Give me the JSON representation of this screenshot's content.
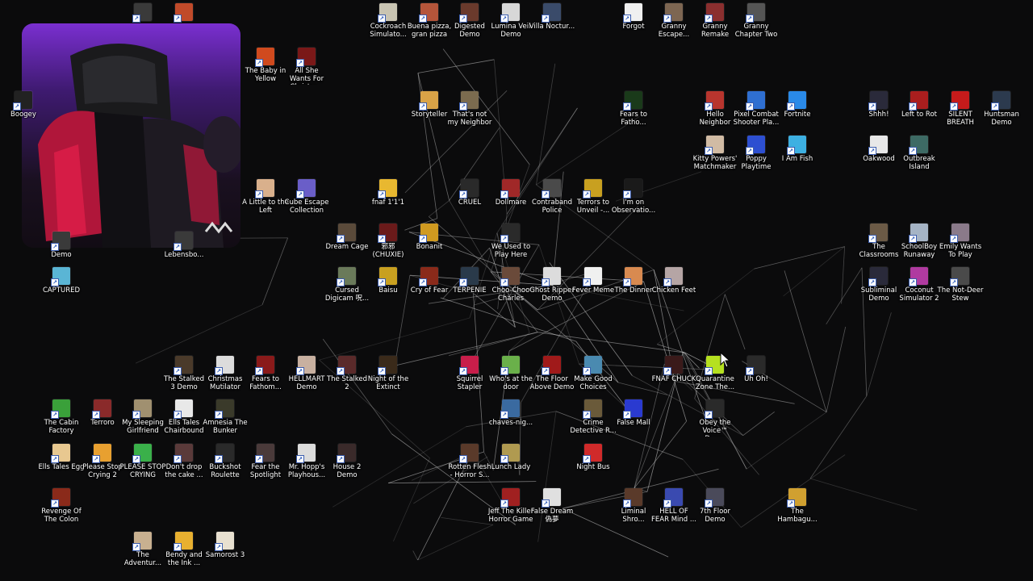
{
  "desktop": {
    "icons": [
      {
        "label": "Cockroach Simulato...",
        "color": "#c9c4b2"
      },
      {
        "label": "Buena pizza, gran pizza",
        "color": "#b5553a"
      },
      {
        "label": "Digested Demo",
        "color": "#6a3a2c"
      },
      {
        "label": "Lumina Veil Demo",
        "color": "#d8d8d8"
      },
      {
        "label": "Villa Noctur...",
        "color": "#3a4b6a"
      },
      {
        "label": "Forgot",
        "color": "#f0f0f0"
      },
      {
        "label": "Granny Escape...",
        "color": "#7d6652"
      },
      {
        "label": "Granny Remake",
        "color": "#8b2f2f"
      },
      {
        "label": "Granny Chapter Two",
        "color": "#555555"
      },
      {
        "label": "The Baby in Yellow",
        "color": "#d04a1e"
      },
      {
        "label": "All She Wants For Christm...",
        "color": "#7a1818"
      },
      {
        "label": "Boogey",
        "color": "#222222"
      },
      {
        "label": "Storyteller",
        "color": "#d9a347"
      },
      {
        "label": "That's not my Neighbor",
        "color": "#7b6b4f"
      },
      {
        "label": "Fears to Fatho...",
        "color": "#1a3a1a"
      },
      {
        "label": "Hello Neighbor",
        "color": "#b8352e"
      },
      {
        "label": "Pixel Combat Shooter Pla...",
        "color": "#2f6fd1"
      },
      {
        "label": "Fortnite",
        "color": "#2a8ae8"
      },
      {
        "label": "Shhh!",
        "color": "#2a2a3a"
      },
      {
        "label": "Left to Rot",
        "color": "#aa1e1e"
      },
      {
        "label": "SILENT BREATH",
        "color": "#c51b1b"
      },
      {
        "label": "Huntsman Demo",
        "color": "#2c3a4e"
      },
      {
        "label": "Kitty Powers' Matchmaker",
        "color": "#d1bba4"
      },
      {
        "label": "Poppy Playtime",
        "color": "#2d4fd1"
      },
      {
        "label": "I Am Fish",
        "color": "#3db0e2"
      },
      {
        "label": "Oakwood",
        "color": "#e8e8e8"
      },
      {
        "label": "Outbreak Island",
        "color": "#3d6a64"
      },
      {
        "label": "A Little to the Left",
        "color": "#d9b08c"
      },
      {
        "label": "Cube Escape Collection",
        "color": "#6a5ec8"
      },
      {
        "label": "fnaf 1'1'1",
        "color": "#e8b830"
      },
      {
        "label": "CRUEL",
        "color": "#2a2a2a"
      },
      {
        "label": "Dollmare",
        "color": "#a02828"
      },
      {
        "label": "Contraband Police",
        "color": "#4a4a4a"
      },
      {
        "label": "Terrors to Unveil -...",
        "color": "#c8a020"
      },
      {
        "label": "I'm on Observatio...",
        "color": "#1a1a1a"
      },
      {
        "label": "The Classrooms",
        "color": "#6b5a46"
      },
      {
        "label": "SchoolBoy Runaway",
        "color": "#a5b4c5"
      },
      {
        "label": "Emily Wants To Play",
        "color": "#8a7a8a"
      },
      {
        "label": "Dream Cage",
        "color": "#5a4a3a"
      },
      {
        "label": "邪邪 (CHUXIE)",
        "color": "#6a1a1a"
      },
      {
        "label": "Bonanit",
        "color": "#d09a20"
      },
      {
        "label": "We Used to Play Here",
        "color": "#2a2a2a"
      },
      {
        "label": "Demo",
        "color": "#3a3a3a"
      },
      {
        "label": "Lebensbo...",
        "color": "#3a3a3a"
      },
      {
        "label": "CAPTURED",
        "color": "#5ab5d5"
      },
      {
        "label": "Cursed Digicam 呪...",
        "color": "#6a7a5a"
      },
      {
        "label": "Baisu",
        "color": "#c8a020"
      },
      {
        "label": "Cry of Fear",
        "color": "#8a2a1a"
      },
      {
        "label": "TERPENIE",
        "color": "#2a3a4a"
      },
      {
        "label": "Choo-Choo Charles",
        "color": "#6a4a3a"
      },
      {
        "label": "Ghost Ripper Demo",
        "color": "#dcdcdc"
      },
      {
        "label": "Fever Meme",
        "color": "#f0f0f0"
      },
      {
        "label": "The Dinner",
        "color": "#d88a50"
      },
      {
        "label": "Chicken Feet",
        "color": "#b5a5a5"
      },
      {
        "label": "Subliminal Demo",
        "color": "#2a2a3a"
      },
      {
        "label": "Coconut Simulator 2",
        "color": "#b03aa0"
      },
      {
        "label": "The Not-Deer Stew",
        "color": "#4a4a4a"
      },
      {
        "label": "The Stalked 3 Demo",
        "color": "#4a3a2a"
      },
      {
        "label": "Christmas Mutilator",
        "color": "#dcdcdc"
      },
      {
        "label": "Fears to Fathom...",
        "color": "#8a1a1a"
      },
      {
        "label": "HELLMART Demo",
        "color": "#c8b0a0"
      },
      {
        "label": "The Stalked 2",
        "color": "#5a2a2a"
      },
      {
        "label": "Night of the Extinct",
        "color": "#3a2a1a"
      },
      {
        "label": "Squirrel Stapler",
        "color": "#c81e4a"
      },
      {
        "label": "Who's at the door",
        "color": "#6ab04a"
      },
      {
        "label": "The Floor Above Demo",
        "color": "#a01a1a"
      },
      {
        "label": "Make Good Choices",
        "color": "#4a8ab0"
      },
      {
        "label": "FNAF CHUCK",
        "color": "#3a1a1a"
      },
      {
        "label": "Quarantine Zone The...",
        "color": "#b5e020"
      },
      {
        "label": "Uh Oh!",
        "color": "#2a2a2a"
      },
      {
        "label": "The Cabin Factory",
        "color": "#3aa03a"
      },
      {
        "label": "Terroro",
        "color": "#8a2a2a"
      },
      {
        "label": "My Sleeping Girlfriend",
        "color": "#a09070"
      },
      {
        "label": "Ells Tales Chairbound",
        "color": "#e8e8e8"
      },
      {
        "label": "Amnesia The Bunker",
        "color": "#3a3a2a"
      },
      {
        "label": "chaves-nig...",
        "color": "#3a6aa0"
      },
      {
        "label": "Crime Detective R...",
        "color": "#6a5a3a"
      },
      {
        "label": "False Mall",
        "color": "#2a3ad0"
      },
      {
        "label": "Obey the Voice™ Demo",
        "color": "#2a2a2a"
      },
      {
        "label": "Ells Tales Egg",
        "color": "#e8c890"
      },
      {
        "label": "Please Stop Crying 2",
        "color": "#e8a030"
      },
      {
        "label": "PLEASE STOP CRYING",
        "color": "#3ab04a"
      },
      {
        "label": "Don't drop the cake ...",
        "color": "#5a3a3a"
      },
      {
        "label": "Buckshot Roulette",
        "color": "#2a2a2a"
      },
      {
        "label": "Fear the Spotlight",
        "color": "#4a3a3a"
      },
      {
        "label": "Mr. Hopp's Playhous...",
        "color": "#dcdcdc"
      },
      {
        "label": "House 2 Demo",
        "color": "#3a2a2a"
      },
      {
        "label": "Rotten Flesh - Horror S...",
        "color": "#5a3a2a"
      },
      {
        "label": "Lunch Lady",
        "color": "#b09a50"
      },
      {
        "label": "Night Bus",
        "color": "#d02a2a"
      },
      {
        "label": "Revenge Of The Colon",
        "color": "#8a2a1a"
      },
      {
        "label": "Jeff The Killer Horror Game",
        "color": "#a02020"
      },
      {
        "label": "False Dream 偽夢",
        "color": "#e0e0e0"
      },
      {
        "label": "Liminal Shro...",
        "color": "#5a3a2a"
      },
      {
        "label": "HELL OF FEAR Mind ...",
        "color": "#3a4ab0"
      },
      {
        "label": "7th Floor Demo",
        "color": "#4a4a5a"
      },
      {
        "label": "The Hambagu...",
        "color": "#d0a030"
      },
      {
        "label": "The Adventur...",
        "color": "#c8b090"
      },
      {
        "label": "Bendy and the Ink ...",
        "color": "#e8b030"
      },
      {
        "label": "Samorost 3",
        "color": "#e8e0d0"
      },
      {
        "label": "",
        "color": "#3a3a3a"
      },
      {
        "label": "",
        "color": "#c04a2a"
      }
    ]
  }
}
